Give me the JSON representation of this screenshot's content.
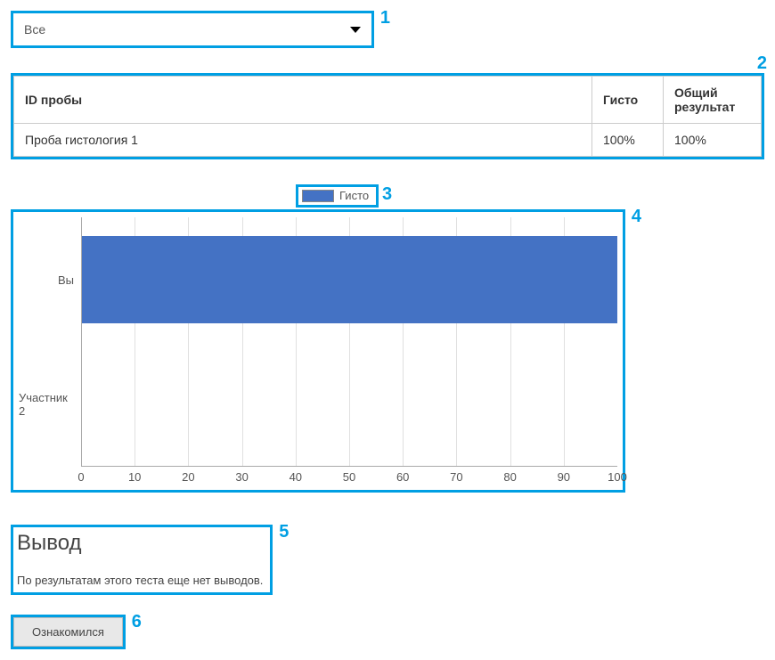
{
  "annotations": {
    "dropdown": "1",
    "table": "2",
    "legend": "3",
    "chart": "4",
    "conclusion": "5",
    "button": "6"
  },
  "filter": {
    "selected": "Все"
  },
  "table": {
    "headers": {
      "id": "ID пробы",
      "gisto": "Гисто",
      "result": "Общий результат"
    },
    "rows": [
      {
        "id": "Проба гистология 1",
        "gisto": "100%",
        "result": "100%"
      }
    ]
  },
  "chart_data": {
    "type": "bar",
    "orientation": "horizontal",
    "legend": "Гисто",
    "categories": [
      "Вы",
      "Участник 2"
    ],
    "values": [
      100,
      0
    ],
    "xlim": [
      0,
      100
    ],
    "xticks": [
      0,
      10,
      20,
      30,
      40,
      50,
      60,
      70,
      80,
      90,
      100
    ],
    "bar_color": "#4472c4"
  },
  "conclusion": {
    "title": "Вывод",
    "text": "По результатам этого теста еще нет выводов."
  },
  "button": {
    "label": "Ознакомился"
  }
}
